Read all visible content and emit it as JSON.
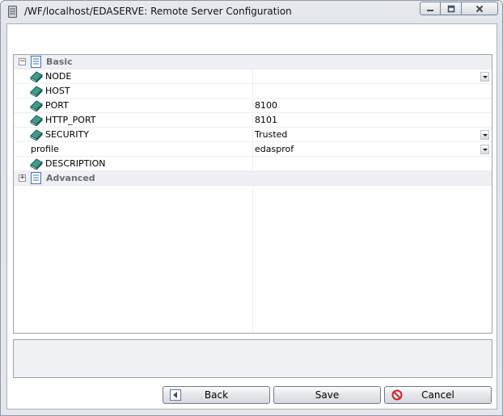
{
  "window": {
    "title": "/WF/localhost/EDASERVE: Remote Server Configuration"
  },
  "grid": {
    "categories": [
      {
        "label": "Basic",
        "expanded": true,
        "toggle": "−"
      },
      {
        "label": "Advanced",
        "expanded": false,
        "toggle": "+"
      }
    ],
    "properties": [
      {
        "name": "NODE",
        "value": "",
        "has_dropdown": true
      },
      {
        "name": "HOST",
        "value": "",
        "has_dropdown": false
      },
      {
        "name": "PORT",
        "value": "8100",
        "has_dropdown": false
      },
      {
        "name": "HTTP_PORT",
        "value": "8101",
        "has_dropdown": false
      },
      {
        "name": "SECURITY",
        "value": "Trusted",
        "has_dropdown": true
      },
      {
        "name": "profile",
        "value": "edasprof",
        "has_dropdown": true
      },
      {
        "name": "DESCRIPTION",
        "value": "",
        "has_dropdown": false
      }
    ]
  },
  "buttons": {
    "back": "Back",
    "save": "Save",
    "cancel": "Cancel"
  }
}
